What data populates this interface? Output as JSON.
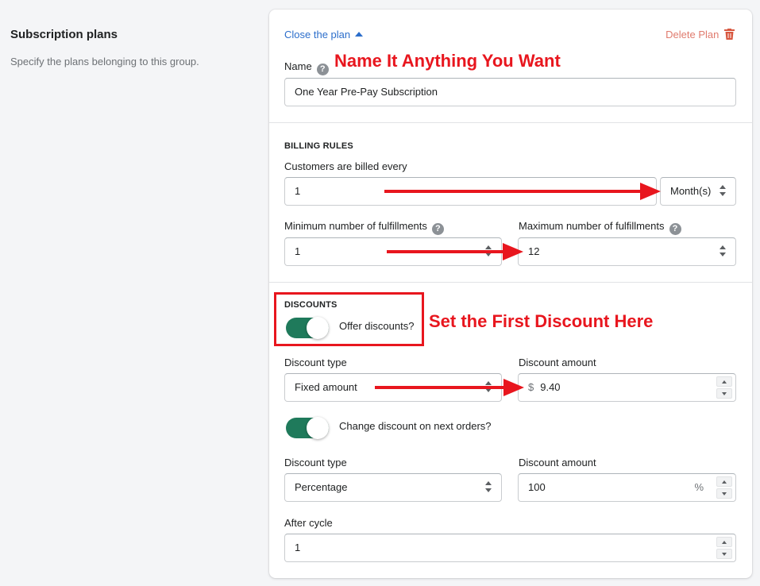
{
  "left_panel": {
    "title": "Subscription plans",
    "description": "Specify the plans belonging to this group."
  },
  "plan": {
    "close_link": "Close the plan",
    "delete_label": "Delete Plan",
    "name_label": "Name",
    "name_value": "One Year Pre-Pay Subscription"
  },
  "billing": {
    "heading": "BILLING RULES",
    "billed_every_label": "Customers are billed every",
    "billed_every_value": "1",
    "interval_value": "Month(s)",
    "min_label": "Minimum number of fulfillments",
    "min_value": "1",
    "max_label": "Maximum number of fulfillments",
    "max_value": "12"
  },
  "discounts": {
    "heading": "DISCOUNTS",
    "offer_label": "Offer discounts?",
    "offer_enabled": true,
    "type_label": "Discount type",
    "type_value": "Fixed amount",
    "amount_label": "Discount amount",
    "currency_prefix": "$",
    "amount_value": "9.40",
    "change_label": "Change discount on next orders?",
    "change_enabled": true,
    "next_type_label": "Discount type",
    "next_type_value": "Percentage",
    "next_amount_label": "Discount amount",
    "next_amount_value": "100",
    "next_amount_suffix": "%",
    "after_cycle_label": "After cycle",
    "after_cycle_value": "1"
  },
  "annotations": {
    "name_note": "Name It Anything You Want",
    "discount_note": "Set the First Discount Here",
    "color": "#e8161e"
  },
  "icons": {
    "help": "question-circle-icon",
    "delete": "trash-icon",
    "caret": "caret-up-icon",
    "select": "select-arrows-icon"
  },
  "colors": {
    "toggle_on": "#1f7a5b",
    "link": "#2c6ecb",
    "delete": "#e07b6e"
  }
}
